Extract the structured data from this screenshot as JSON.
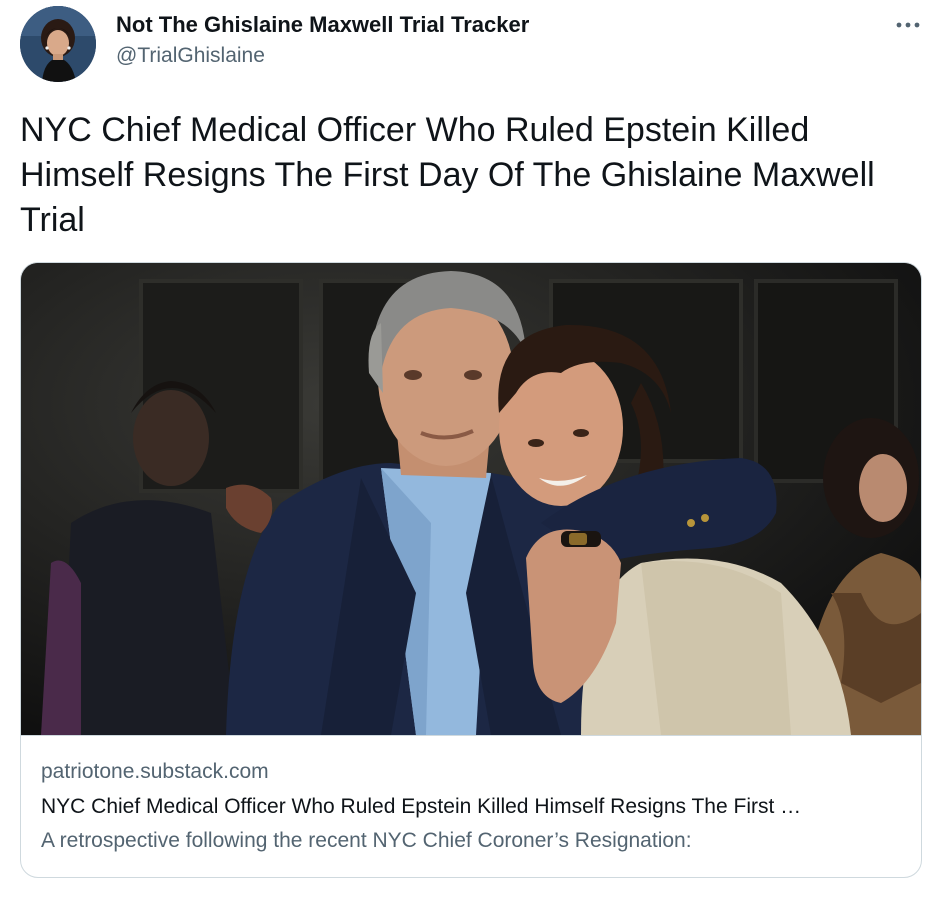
{
  "author": {
    "display_name": "Not The Ghislaine Maxwell Trial Tracker",
    "handle": "@TrialGhislaine",
    "avatar_icon": "profile-photo"
  },
  "menu": {
    "icon": "more-options-icon"
  },
  "tweet": {
    "text": "NYC Chief Medical Officer Who Ruled Epstein Killed Himself Resigns The First Day Of The Ghislaine Maxwell Trial"
  },
  "link_card": {
    "domain": "patriotone.substack.com",
    "title": "NYC Chief Medical Officer Who Ruled Epstein Killed Himself Resigns The First …",
    "description": "A retrospective following the recent NYC Chief Coroner’s Resignation:"
  },
  "colors": {
    "text_primary": "#0f1419",
    "text_secondary": "#536471",
    "border": "#cfd9de"
  }
}
